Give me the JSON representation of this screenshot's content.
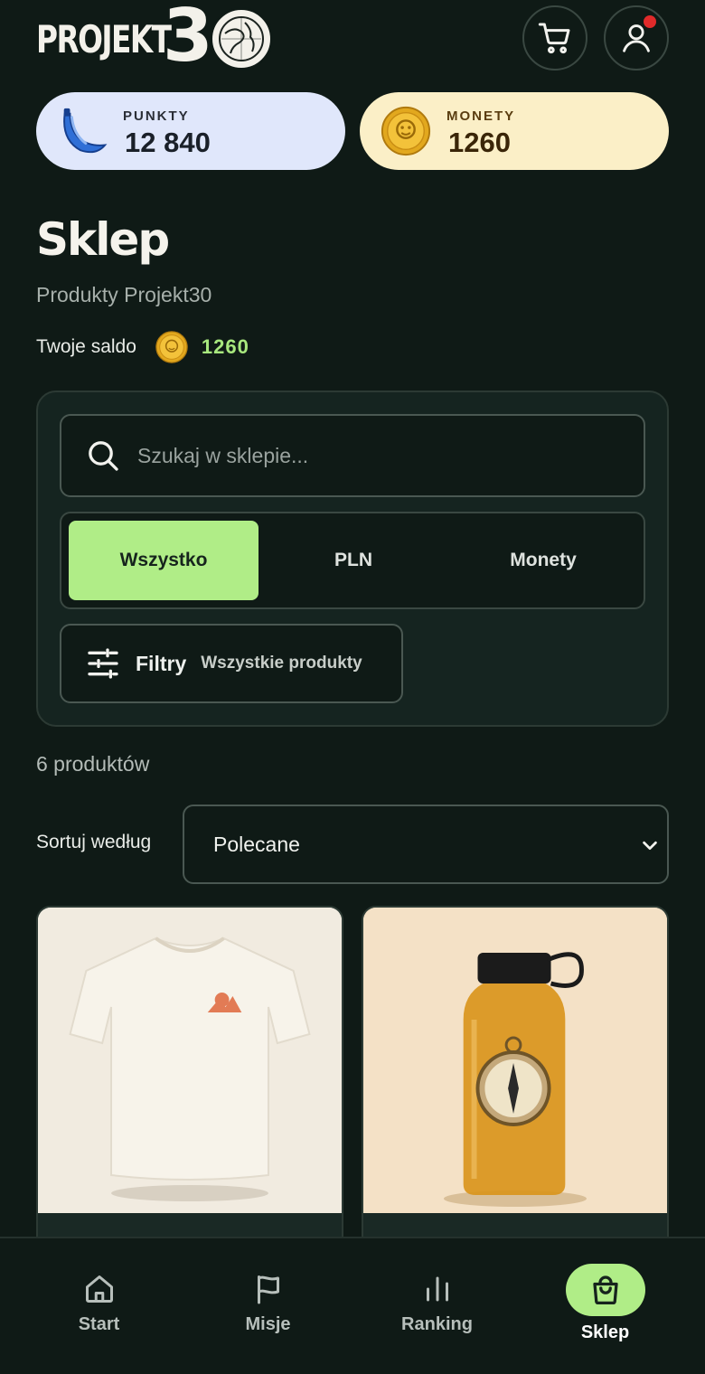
{
  "header": {
    "logo_text": "PROJEKT",
    "logo_number": "30",
    "cart_icon": "cart-icon",
    "user_icon": "user-icon",
    "notification_color": "#e02a2a"
  },
  "stats": {
    "points": {
      "label": "PUNKTY",
      "value": "12 840",
      "icon": "banana-icon"
    },
    "coins": {
      "label": "MONETY",
      "value": "1260",
      "icon": "coin-icon"
    }
  },
  "page": {
    "title": "Sklep",
    "subtitle": "Produkty Projekt30",
    "balance_label": "Twoje saldo",
    "balance_value": "1260"
  },
  "filters_panel": {
    "search_placeholder": "Szukaj w sklepie...",
    "segments": [
      {
        "label": "Wszystko",
        "active": true
      },
      {
        "label": "PLN",
        "active": false
      },
      {
        "label": "Monety",
        "active": false
      }
    ],
    "filters_label": "Filtry",
    "filters_value": "Wszystkie produkty"
  },
  "listing": {
    "count_text": "6 produktów",
    "sort_label": "Sortuj według",
    "sort_value": "Polecane"
  },
  "products": [
    {
      "name": "",
      "image": "t-shirt"
    },
    {
      "name": "",
      "image": "water-bottle"
    }
  ],
  "nav": [
    {
      "label": "Start",
      "icon": "home-icon",
      "active": false
    },
    {
      "label": "Misje",
      "icon": "flag-icon",
      "active": false
    },
    {
      "label": "Ranking",
      "icon": "bar-chart-icon",
      "active": false
    },
    {
      "label": "Sklep",
      "icon": "shopping-bag-icon",
      "active": true
    }
  ],
  "colors": {
    "background": "#0f1a16",
    "accent": "#b0ed87",
    "balance": "#a8e87e",
    "points_card": "#e0e7fb",
    "coins_card": "#fbefc7"
  }
}
